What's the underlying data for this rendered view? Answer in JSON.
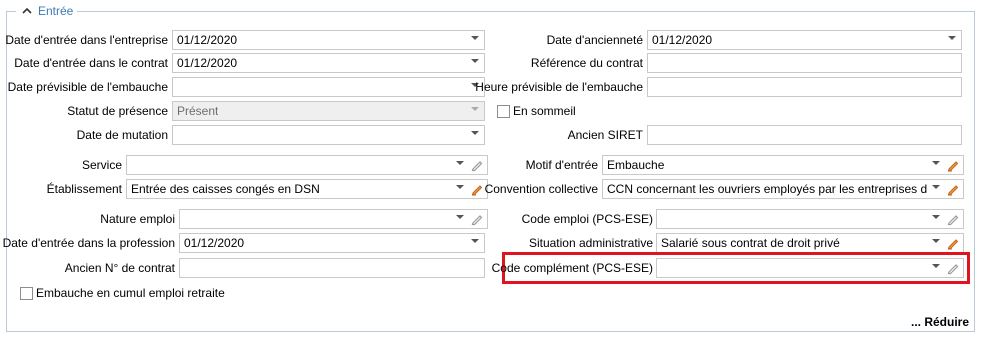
{
  "section": {
    "title": "Entrée",
    "reduce_label": "... Réduire"
  },
  "left": {
    "date_entree_entreprise": {
      "label": "Date d'entrée dans l'entreprise",
      "value": "01/12/2020"
    },
    "date_entree_contrat": {
      "label": "Date d'entrée dans le contrat",
      "value": "01/12/2020"
    },
    "date_previsible_embauche": {
      "label": "Date prévisible de l'embauche",
      "value": ""
    },
    "statut_presence": {
      "label": "Statut de présence",
      "value": "Présent"
    },
    "date_mutation": {
      "label": "Date de mutation",
      "value": ""
    },
    "service": {
      "label": "Service",
      "value": ""
    },
    "etablissement": {
      "label": "Établissement",
      "value": "Entrée des caisses congés en DSN"
    },
    "nature_emploi": {
      "label": "Nature emploi",
      "value": ""
    },
    "date_entree_profession": {
      "label": "Date d'entrée dans la profession",
      "value": "01/12/2020"
    },
    "ancien_num_contrat": {
      "label": "Ancien N° de contrat",
      "value": ""
    },
    "embauche_cumul": {
      "label": "Embauche en cumul emploi retraite",
      "checked": false
    }
  },
  "right": {
    "date_anciennete": {
      "label": "Date d'ancienneté",
      "value": "01/12/2020"
    },
    "reference_contrat": {
      "label": "Référence du contrat",
      "value": ""
    },
    "heure_previsible": {
      "label": "Heure prévisible de l'embauche",
      "value": ""
    },
    "en_sommeil": {
      "label": "En sommeil",
      "checked": false
    },
    "ancien_siret": {
      "label": "Ancien SIRET",
      "value": ""
    },
    "motif_entree": {
      "label": "Motif d'entrée",
      "value": "Embauche"
    },
    "convention_collective": {
      "label": "Convention collective",
      "value": "CCN concernant les ouvriers employés par les entreprises du bâtime"
    },
    "code_emploi": {
      "label": "Code emploi (PCS-ESE)",
      "value": ""
    },
    "situation_administrative": {
      "label": "Situation administrative",
      "value": "Salarié sous contrat de droit privé"
    },
    "code_complement": {
      "label": "Code complément (PCS-ESE)",
      "value": ""
    }
  },
  "colors": {
    "highlight": "#e0141e",
    "legend": "#3b7ab5",
    "border": "#b9c9d6",
    "pencil_active": "#e07a10",
    "pencil_inactive": "#9a9a9a"
  }
}
